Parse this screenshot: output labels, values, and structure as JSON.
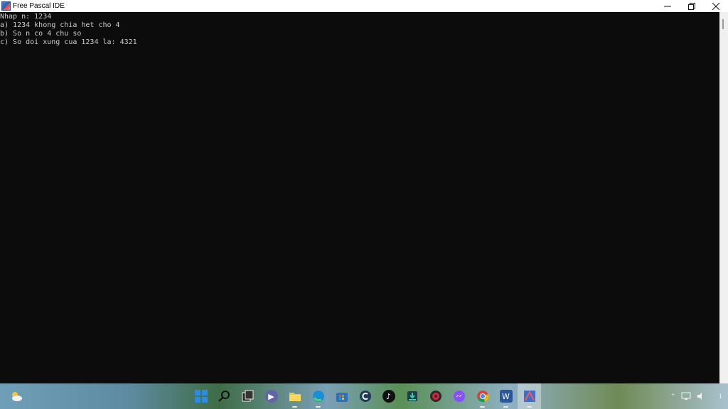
{
  "window": {
    "title": "Free Pascal IDE",
    "controls": {
      "minimize_icon": "minimize-icon",
      "maximize_icon": "restore-icon",
      "close_icon": "close-icon"
    }
  },
  "console": {
    "lines": [
      "Nhap n: 1234",
      "a) 1234 khong chia het cho 4",
      "b) So n co 4 chu so",
      "c) So doi xung cua 1234 la: 4321"
    ],
    "background": "#0c0c0c",
    "text_color": "#cccccc"
  },
  "taskbar": {
    "items": [
      {
        "name": "start-button",
        "icon": "windows-icon"
      },
      {
        "name": "search-button",
        "icon": "search-icon"
      },
      {
        "name": "task-view-button",
        "icon": "task-view-icon"
      },
      {
        "name": "teams-chat-button",
        "icon": "video-chat-icon"
      },
      {
        "name": "file-explorer-button",
        "icon": "folder-icon"
      },
      {
        "name": "edge-button",
        "icon": "edge-icon"
      },
      {
        "name": "store-button",
        "icon": "store-icon"
      },
      {
        "name": "ccleaner-button",
        "icon": "c-circle-icon"
      },
      {
        "name": "tiktok-button",
        "icon": "tiktok-icon"
      },
      {
        "name": "app-button",
        "icon": "download-app-icon"
      },
      {
        "name": "davinci-button",
        "icon": "resolve-icon"
      },
      {
        "name": "messenger-button",
        "icon": "messenger-icon"
      },
      {
        "name": "chrome-button",
        "icon": "chrome-icon"
      },
      {
        "name": "word-button",
        "icon": "word-icon"
      },
      {
        "name": "free-pascal-button",
        "icon": "free-pascal-icon"
      }
    ],
    "tray": {
      "notification_count": "1"
    }
  }
}
